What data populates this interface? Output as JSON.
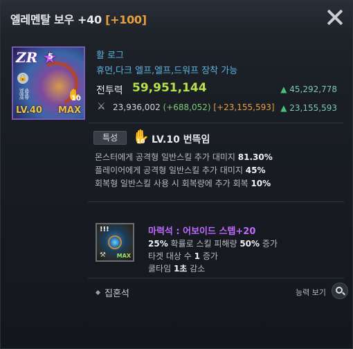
{
  "header": {
    "title": "엘레멘탈 보우 +40",
    "bonus": "[+100]"
  },
  "item": {
    "grade_badge": "ZR",
    "star_count": "5",
    "level_label": "LV.40",
    "max_label": "MAX",
    "hand_count": "10",
    "type": "활 로그",
    "races": "휴먼,다크 엘프,엘프,드워프 장착 가능",
    "power_label": "전투력",
    "power_value": "59,951,144",
    "power_delta": "45,292,778",
    "attack_base": "23,936,002",
    "attack_bonus_green": "(+688,052)",
    "attack_bonus_orange": "[+23,155,593]",
    "attack_delta": "23,155,593"
  },
  "trait": {
    "tag": "특성",
    "icon_num": "10",
    "name": "LV.10 번뜩임",
    "lines": [
      {
        "text": "몬스터에게 공격형 일반스킬 추가 대미지 ",
        "value": "81.30%"
      },
      {
        "text": "플레이어에게 공격형 일반스킬 추가 대미지 ",
        "value": "45%"
      },
      {
        "text": "회복형 일반스킬 사용 시 회복량에 추가 회복 ",
        "value": "10%"
      }
    ]
  },
  "magic_stone": {
    "icon_badge": "!!!",
    "max_label": "MAX",
    "name": "마력석 : 어보이드 스텝+20",
    "line1_a": "25%",
    "line1_b": " 확률로 스킬 피해량 ",
    "line1_c": "50%",
    "line1_d": " 증가",
    "line2_a": "타겟 대상 수 ",
    "line2_b": "1",
    "line2_c": " 증가",
    "line3_a": "쿨타임 ",
    "line3_b": "1초",
    "line3_c": " 감소"
  },
  "footer": {
    "soul_label": "집혼석",
    "ability_label": "능력 보기"
  },
  "colors": {
    "accent_orange": "#e8a040",
    "power_green": "#b7e04a",
    "type_blue": "#5fb3e0",
    "stone_purple": "#c06aff"
  }
}
